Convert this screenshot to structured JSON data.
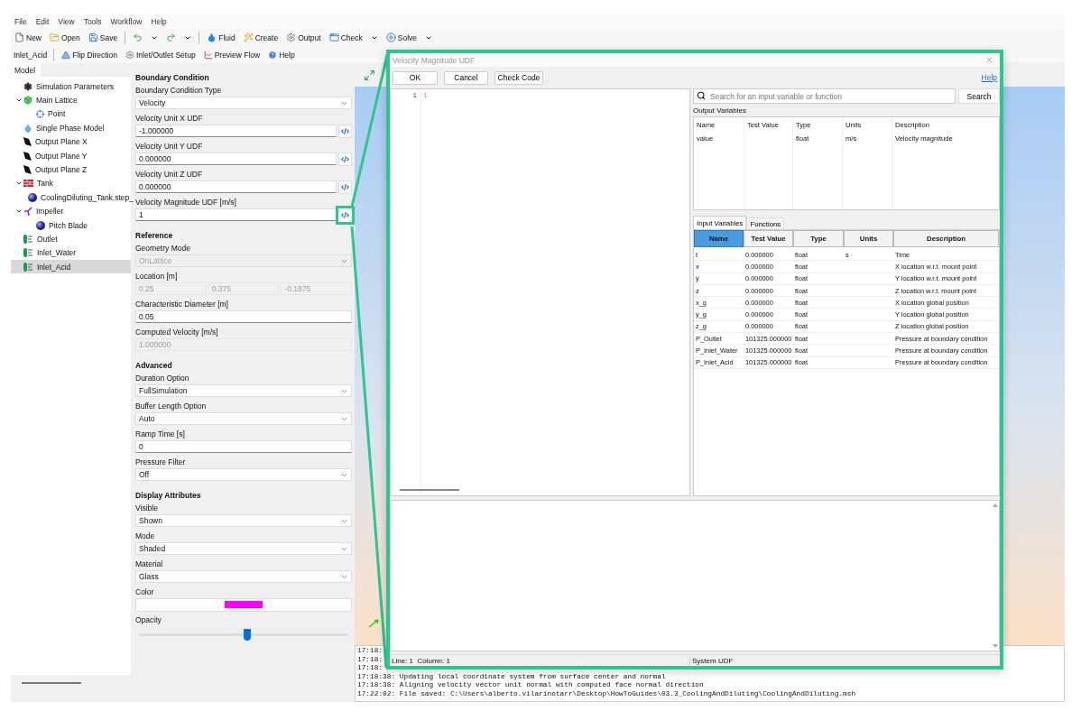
{
  "menu": [
    "File",
    "Edit",
    "View",
    "Tools",
    "Workflow",
    "Help"
  ],
  "toolbar": [
    {
      "kind": "button",
      "label": "New"
    },
    {
      "kind": "button",
      "label": "Open"
    },
    {
      "kind": "button",
      "label": "Save"
    },
    {
      "kind": "separator"
    },
    {
      "kind": "icon"
    },
    {
      "kind": "caret"
    },
    {
      "kind": "icon"
    },
    {
      "kind": "caret"
    },
    {
      "kind": "separator"
    },
    {
      "kind": "button",
      "label": "Fluid"
    },
    {
      "kind": "button",
      "label": "Create"
    },
    {
      "kind": "button",
      "label": "Output"
    },
    {
      "kind": "button",
      "label": "Check"
    },
    {
      "kind": "caret"
    },
    {
      "kind": "button",
      "label": "Solve"
    },
    {
      "kind": "caret"
    }
  ],
  "context_toolbar": [
    {
      "kind": "title",
      "label": "Inlet_Acid"
    },
    {
      "kind": "separator"
    },
    {
      "kind": "button",
      "label": "Flip Direction"
    },
    {
      "kind": "button",
      "label": "Inlet/Outlet Setup"
    },
    {
      "kind": "button",
      "label": "Preview Flow"
    },
    {
      "kind": "button",
      "label": "Help"
    }
  ],
  "model_panel": {
    "tab": "Model",
    "tree": [
      {
        "kind": "settings",
        "label": "Simulation Parameters",
        "selected": false
      },
      {
        "kind": "lattice",
        "label": "Main Lattice",
        "selected": false,
        "expanded": true,
        "children": [
          {
            "kind": "point",
            "label": "Point",
            "selected": false
          }
        ]
      },
      {
        "kind": "phase",
        "label": "Single Phase Model",
        "selected": false
      },
      {
        "kind": "plane",
        "label": "Output Plane X",
        "selected": false
      },
      {
        "kind": "plane",
        "label": "Output Plane Y",
        "selected": false
      },
      {
        "kind": "plane",
        "label": "Output Plane Z",
        "selected": false
      },
      {
        "kind": "tank",
        "label": "Tank",
        "selected": false,
        "expanded": true,
        "children": [
          {
            "kind": "geometry",
            "label": "CoolingDiluting_Tank.step_",
            "selected": false
          }
        ]
      },
      {
        "kind": "rotor",
        "label": "Impeller",
        "selected": false,
        "expanded": true,
        "children": [
          {
            "kind": "geometry",
            "label": "Pitch Blade",
            "selected": false
          }
        ]
      },
      {
        "kind": "boundary",
        "label": "Outlet",
        "selected": false
      },
      {
        "kind": "boundary",
        "label": "Inlet_Water",
        "selected": false
      },
      {
        "kind": "boundary",
        "label": "Inlet_Acid",
        "selected": true
      }
    ]
  },
  "properties": [
    {
      "title": "Boundary Condition",
      "fields": [
        {
          "kind": "select",
          "label": "Boundary Condition Type",
          "value": "Velocity",
          "disabled": false
        },
        {
          "kind": "udf",
          "label": "Velocity Unit X UDF",
          "value": "-1.000000",
          "highlighted": false
        },
        {
          "kind": "udf",
          "label": "Velocity Unit Y UDF",
          "value": "0.000000",
          "highlighted": false
        },
        {
          "kind": "udf",
          "label": "Velocity Unit Z UDF",
          "value": "0.000000",
          "highlighted": false
        },
        {
          "kind": "udf",
          "label": "Velocity Magnitude UDF [m/s]",
          "value": "1",
          "highlighted": true
        }
      ]
    },
    {
      "title": "Reference",
      "fields": [
        {
          "kind": "select",
          "label": "Geometry Mode",
          "value": "OnLattice",
          "disabled": true
        },
        {
          "kind": "vector",
          "label": "Location [m]",
          "values": [
            "0.25",
            "0.375",
            "-0.1875"
          ],
          "disabled": true
        },
        {
          "kind": "input",
          "label": "Characteristic Diameter [m]",
          "value": "0.05",
          "disabled": false
        },
        {
          "kind": "input",
          "label": "Computed Velocity [m/s]",
          "value": "1.000000",
          "disabled": true
        }
      ]
    },
    {
      "title": "Advanced",
      "fields": [
        {
          "kind": "select",
          "label": "Duration Option",
          "value": "FullSimulation",
          "disabled": false
        },
        {
          "kind": "select",
          "label": "Buffer Length Option",
          "value": "Auto",
          "disabled": false
        },
        {
          "kind": "input",
          "label": "Ramp Time [s]",
          "value": "0",
          "disabled": false
        },
        {
          "kind": "select",
          "label": "Pressure Filter",
          "value": "Off",
          "disabled": false
        }
      ]
    },
    {
      "title": "Display Attributes",
      "fields": [
        {
          "kind": "select",
          "label": "Visible",
          "value": "Shown",
          "disabled": false
        },
        {
          "kind": "select",
          "label": "Mode",
          "value": "Shaded",
          "disabled": false
        },
        {
          "kind": "select",
          "label": "Material",
          "value": "Glass",
          "disabled": false
        },
        {
          "kind": "color",
          "label": "Color",
          "color": "#ff00ff"
        },
        {
          "kind": "slider",
          "label": "Opacity",
          "level": 0.5
        }
      ]
    }
  ],
  "log": [
    "17:18:",
    "17:18:",
    "17:18:",
    "17:18:38: Updating local coordinate system from surface center and normal",
    "17:18:38: Aligning velocity vector unit normal with computed face normal direction",
    "17:22:02: File saved: C:\\Users\\alberto.vilarinotarr\\Desktop\\HowToGuides\\03.3_CoolingAndDiluting\\CoolingAndDiluting.msh"
  ],
  "dialog": {
    "title": "Velocity Magnitude UDF",
    "buttons": [
      "OK",
      "Cancel",
      "Check Code"
    ],
    "help": "Help",
    "code_lines": [
      {
        "number": "1",
        "text": "1"
      }
    ],
    "search": {
      "placeholder": "Search for an input variable or function",
      "button": "Search"
    },
    "output_title": "Output Variables",
    "output_columns": [
      {
        "label": "Name"
      },
      {
        "label": "Test Value"
      },
      {
        "label": "Type"
      },
      {
        "label": "Units"
      },
      {
        "label": "Description"
      }
    ],
    "output_rows": [
      {
        "name": "value",
        "type": "float",
        "units": "m/s",
        "description": "Velocity magnitude"
      }
    ],
    "tabs": [
      {
        "label": "Input Variables",
        "selected": true
      },
      {
        "label": "Functions",
        "selected": false
      }
    ],
    "input_columns": [
      {
        "label": "Name",
        "selected": true
      },
      {
        "label": "Test Value",
        "selected": false
      },
      {
        "label": "Type",
        "selected": false
      },
      {
        "label": "Units",
        "selected": false
      },
      {
        "label": "Description",
        "selected": false
      }
    ],
    "input_rows": [
      {
        "name": "t",
        "test_value": "0.000000",
        "type": "float",
        "units": "s",
        "description": "Time"
      },
      {
        "name": "x",
        "test_value": "0.000000",
        "type": "float",
        "description": "X location w.r.t. mount point"
      },
      {
        "name": "y",
        "test_value": "0.000000",
        "type": "float",
        "description": "Y location w.r.t. mount point"
      },
      {
        "name": "z",
        "test_value": "0.000000",
        "type": "float",
        "description": "Z location w.r.t. mount point"
      },
      {
        "name": "x_g",
        "test_value": "0.000000",
        "type": "float",
        "description": "X location global position"
      },
      {
        "name": "y_g",
        "test_value": "0.000000",
        "type": "float",
        "description": "Y location global position"
      },
      {
        "name": "z_g",
        "test_value": "0.000000",
        "type": "float",
        "description": "Z location global position"
      },
      {
        "name": "P_Outlet",
        "test_value": "101325.000000",
        "type": "float",
        "description": "Pressure at boundary condition"
      },
      {
        "name": "P_Inlet_Water",
        "test_value": "101325.000000",
        "type": "float",
        "description": "Pressure at boundary condition"
      },
      {
        "name": "P_Inlet_Acid",
        "test_value": "101325.000000",
        "type": "float",
        "description": "Pressure at boundary condition"
      }
    ],
    "status": [
      "Line: 1  Column: 1",
      "System UDF"
    ]
  }
}
